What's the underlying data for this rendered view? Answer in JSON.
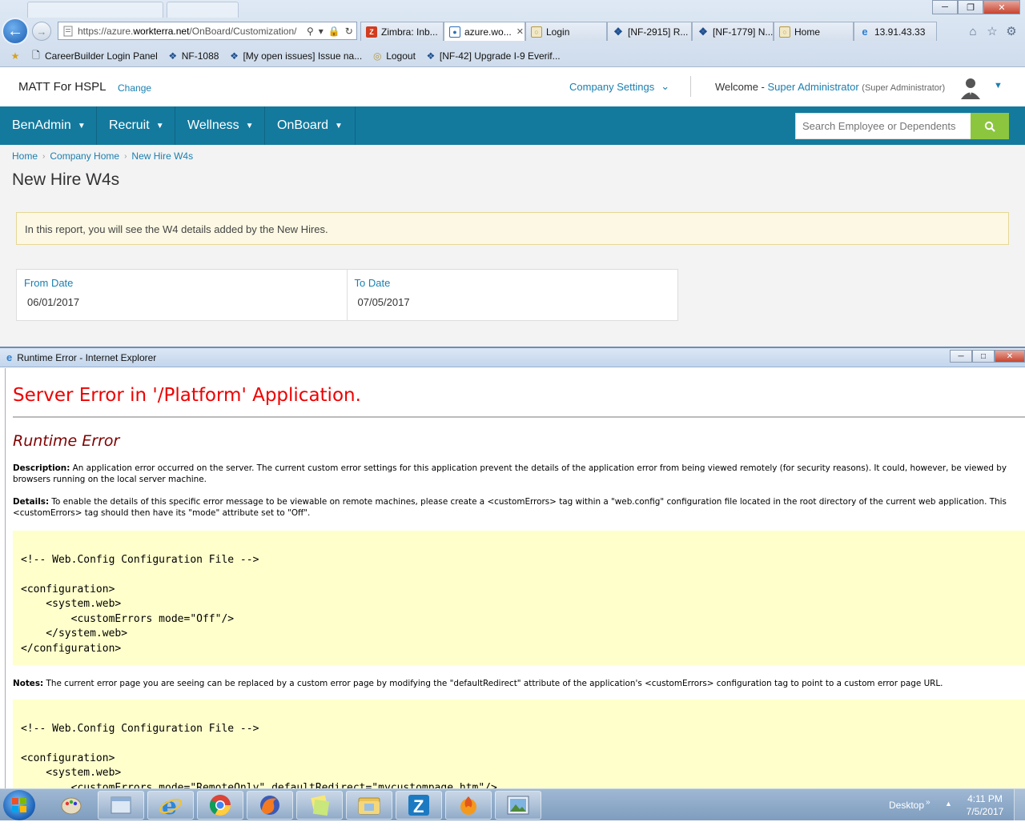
{
  "browser": {
    "address_url_prefix": "https://azure.",
    "address_url_domain": "workterra.net",
    "address_url_path": "/OnBoard/Customization/",
    "tabs": [
      {
        "label": "Zimbra: Inb...",
        "icon": "zimbra-icon",
        "active": false
      },
      {
        "label": "azure.wo...",
        "icon": "workterra-icon",
        "active": true
      },
      {
        "label": "Login",
        "icon": "login-icon",
        "active": false
      },
      {
        "label": "[NF-2915] R...",
        "icon": "jira-icon",
        "active": false
      },
      {
        "label": "[NF-1779] N...",
        "icon": "jira-icon",
        "active": false
      },
      {
        "label": "Home",
        "icon": "home-page-icon",
        "active": false
      },
      {
        "label": "13.91.43.33",
        "icon": "ie-icon",
        "active": false
      }
    ],
    "favorites": [
      {
        "label": "CareerBuilder Login Panel",
        "icon": "page-icon"
      },
      {
        "label": "NF-1088",
        "icon": "jira-icon"
      },
      {
        "label": "[My open issues] Issue na...",
        "icon": "jira-icon"
      },
      {
        "label": "Logout",
        "icon": "logout-icon"
      },
      {
        "label": "[NF-42] Upgrade I-9 Everif...",
        "icon": "jira-icon"
      }
    ]
  },
  "header": {
    "brand": "MATT For HSPL",
    "change_label": "Change",
    "company_settings_label": "Company Settings",
    "welcome_prefix": "Welcome - ",
    "user_name": "Super Administrator",
    "user_role": "(Super Administrator)"
  },
  "nav": {
    "items": [
      {
        "label": "BenAdmin"
      },
      {
        "label": "Recruit"
      },
      {
        "label": "Wellness"
      },
      {
        "label": "OnBoard"
      }
    ],
    "search_placeholder": "Search Employee or Dependents"
  },
  "page": {
    "breadcrumb": [
      "Home",
      "Company Home",
      "New Hire W4s"
    ],
    "title": "New Hire W4s",
    "info": "In this report, you will see the W4 details added by the New Hires.",
    "from_date_label": "From Date",
    "from_date_value": "06/01/2017",
    "to_date_label": "To Date",
    "to_date_value": "07/05/2017"
  },
  "popup": {
    "window_title": "Runtime Error - Internet Explorer",
    "heading": "Server Error in '/Platform' Application.",
    "subheading": "Runtime Error",
    "description_label": "Description:",
    "description_text": " An application error occurred on the server. The current custom error settings for this application prevent the details of the application error from being viewed remotely (for security reasons). It could, however, be viewed by browsers running on the local server machine.",
    "details_label": "Details:",
    "details_text": " To enable the details of this specific error message to be viewable on remote machines, please create a <customErrors> tag within a \"web.config\" configuration file located in the root directory of the current web application. This <customErrors> tag should then have its \"mode\" attribute set to \"Off\".",
    "code1": "\n<!-- Web.Config Configuration File -->\n\n<configuration>\n    <system.web>\n        <customErrors mode=\"Off\"/>\n    </system.web>\n</configuration>",
    "notes_label": "Notes:",
    "notes_text": " The current error page you are seeing can be replaced by a custom error page by modifying the \"defaultRedirect\" attribute of the application's <customErrors> configuration tag to point to a custom error page URL.",
    "code2": "\n<!-- Web.Config Configuration File -->\n\n<configuration>\n    <system.web>\n        <customErrors mode=\"RemoteOnly\" defaultRedirect=\"mycustompage.htm\"/>"
  },
  "taskbar": {
    "desktop_label": "Desktop",
    "time": "4:11 PM",
    "date": "7/5/2017"
  },
  "colors": {
    "nav_bg": "#137a9e",
    "link": "#1a7fb0",
    "search_btn": "#8cc63f",
    "error_red": "#e00000",
    "error_maroon": "#800000",
    "code_bg": "#ffffcc"
  }
}
